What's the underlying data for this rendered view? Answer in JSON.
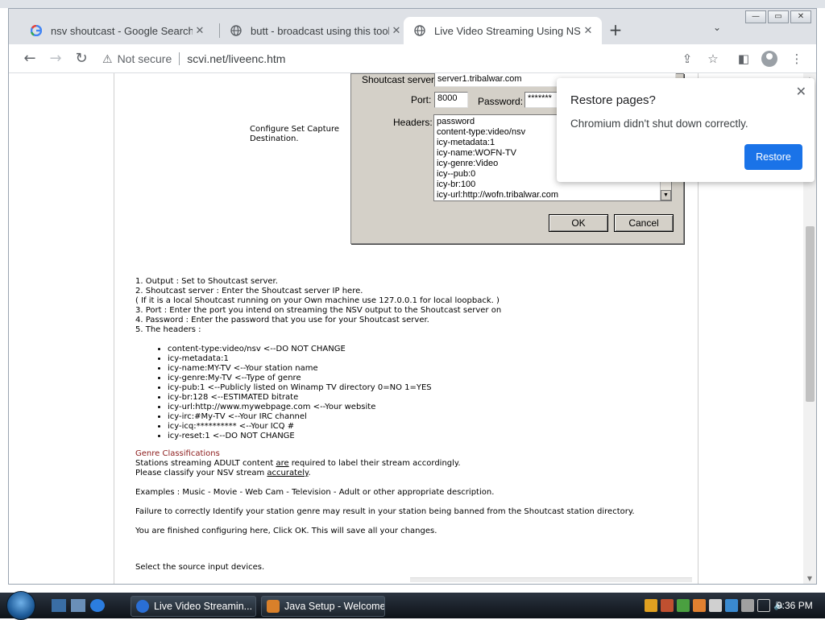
{
  "browser": {
    "tabs": [
      {
        "label": "nsv shoutcast - Google Search",
        "close": "✕"
      },
      {
        "label": "butt - broadcast using this tool",
        "close": "✕"
      },
      {
        "label": "Live Video Streaming Using NSV",
        "close": "✕"
      }
    ],
    "new_tab": "+",
    "tab_menu": "⌄",
    "window_controls": {
      "min": "—",
      "max": "▭",
      "close": "✕"
    },
    "security_label": "Not secure",
    "url": "scvi.net/liveenc.htm"
  },
  "dialog": {
    "server_label": "Shoutcast server:",
    "server_value": "server1.tribalwar.com",
    "port_label": "Port:",
    "port_value": "8000",
    "password_label": "Password:",
    "password_value": "*******",
    "headers_label": "Headers:",
    "headers": [
      "password",
      "content-type:video/nsv",
      "icy-metadata:1",
      "icy-name:WOFN-TV",
      "icy-genre:Video",
      "icy--pub:0",
      "icy-br:100",
      "icy-url:http://wofn.tribalwar.com"
    ],
    "ok": "OK",
    "cancel": "Cancel"
  },
  "page": {
    "caption_1": "Configure Set Capture",
    "caption_2": "Destination.",
    "steps": [
      "1. Output : Set to Shoutcast server.",
      "2. Shoutcast server : Enter the Shoutcast server IP here.",
      "( If it is a local Shoutcast running on your Own machine use 127.0.0.1 for local loopback. )",
      "3. Port : Enter the port you intend on streaming the NSV output to the Shoutcast server on",
      "4. Password : Enter the password that you use for your Shoutcast server.",
      "5. The headers :"
    ],
    "header_items": [
      "content-type:video/nsv <--DO NOT CHANGE",
      "icy-metadata:1",
      "icy-name:MY-TV <--Your station name",
      "icy-genre:My-TV <--Type of genre",
      "icy-pub:1 <--Publicly listed on Winamp TV directory 0=NO 1=YES",
      "icy-br:128 <--ESTIMATED bitrate",
      "icy-url:http://www.mywebpage.com <--Your website",
      "icy-irc:#My-TV <--Your IRC channel",
      "icy-icq:********** <--Your ICQ #",
      "icy-reset:1 <--DO NOT CHANGE"
    ],
    "genre_title": "Genre Classifications",
    "genre_l1_a": "Stations streaming ADULT content ",
    "genre_l1_u": "are",
    "genre_l1_b": " required to label their stream accordingly.",
    "genre_l2_a": "Please classify your NSV stream ",
    "genre_l2_u": "accurately",
    "genre_l2_b": ".",
    "examples": "Examples : Music - Movie - Web Cam - Television - Adult or other appropriate description.",
    "failure": "Failure to correctly Identify your station genre may result in your station being banned from the Shoutcast station directory.",
    "finished": "You are finished configuring here, Click OK.  This will save all your changes.",
    "select_source": "Select the source input devices."
  },
  "popup": {
    "title": "Restore pages?",
    "message": "Chromium didn't shut down correctly.",
    "restore": "Restore",
    "close": "✕"
  },
  "taskbar": {
    "items": [
      {
        "label": "Live Video Streamin...",
        "color": "#2a6fd6"
      },
      {
        "label": "Java Setup - Welcome",
        "color": "#d9802a"
      }
    ],
    "clock": "9:36 PM"
  },
  "colors": {
    "accent": "#1a73e8",
    "genre_title": "#8b1a1a"
  }
}
